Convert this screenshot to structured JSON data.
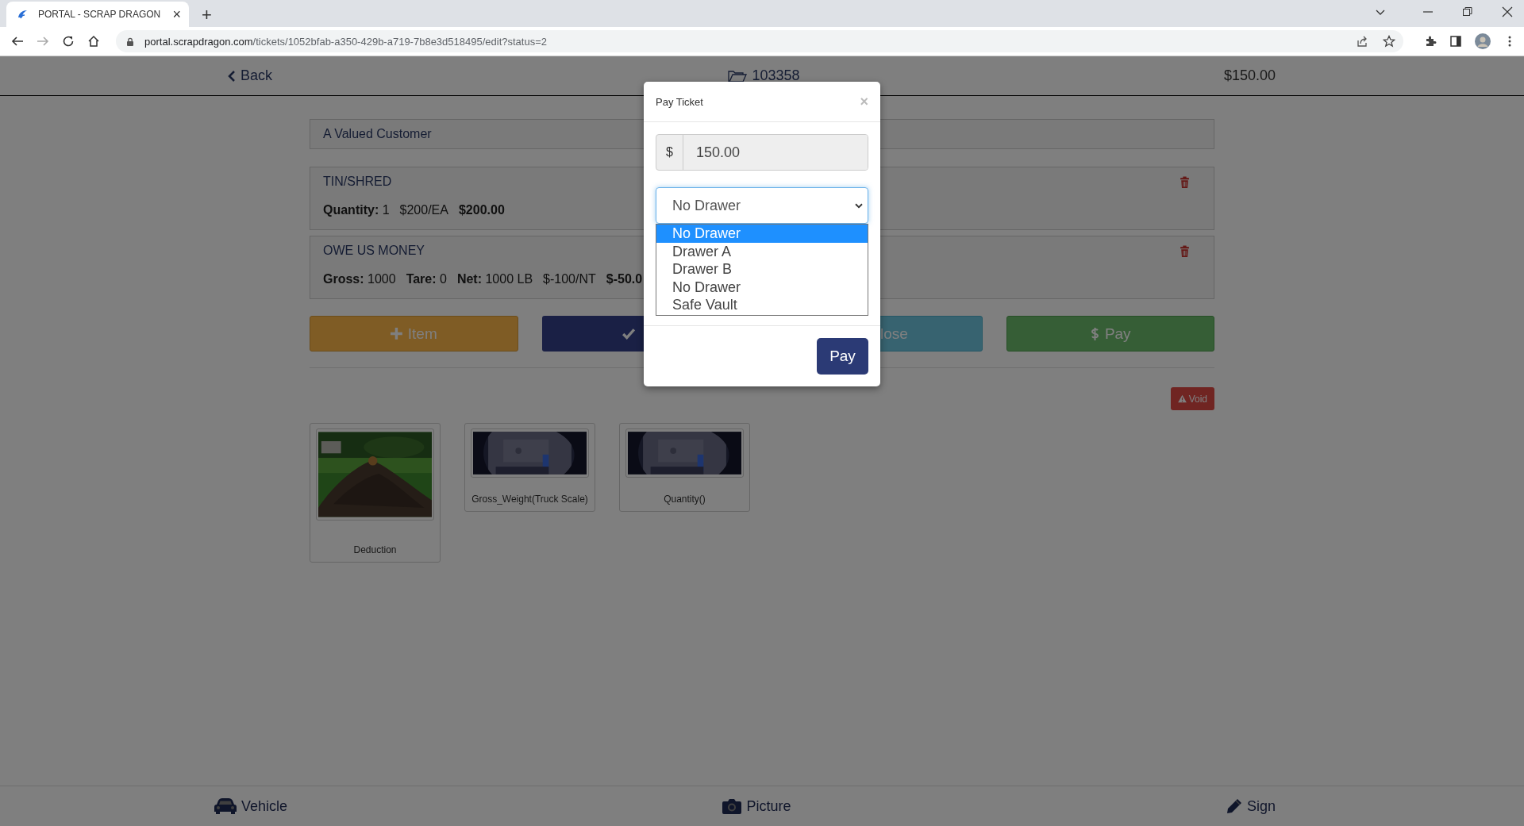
{
  "browser": {
    "tab_title": "PORTAL - SCRAP DRAGON",
    "tab_close": "×",
    "new_tab": "+",
    "url_host": "portal.scrapdragon.com",
    "url_path": "/tickets/1052bfab-a350-429b-a719-7b8e3d518495/edit?status=2"
  },
  "header": {
    "back": "Back",
    "ticket_number": "103358",
    "total": "$150.00"
  },
  "customer": "A Valued Customer",
  "items": [
    {
      "name": "TIN/SHRED",
      "parts": [
        "**Quantity:** 1",
        "$200/EA",
        "**$200.00**"
      ]
    },
    {
      "name": "OWE US MONEY",
      "parts": [
        "**Gross:** 1000",
        "**Tare:** 0",
        "**Net:** 1000 LB",
        "$-100/NT",
        "**$-50.0**"
      ]
    }
  ],
  "actions": [
    {
      "kind": "item",
      "label": "Item"
    },
    {
      "kind": "complete"
    },
    {
      "kind": "close",
      "label": "lose"
    },
    {
      "kind": "pay",
      "label": "Pay"
    }
  ],
  "void": "Void",
  "photos": [
    {
      "caption": "Deduction"
    },
    {
      "caption": "Gross_Weight(Truck Scale)"
    },
    {
      "caption": "Quantity()"
    }
  ],
  "bottom_nav": [
    {
      "kind": "vehicle",
      "label": "Vehicle"
    },
    {
      "kind": "camera",
      "label": "Picture"
    },
    {
      "kind": "pen",
      "label": "Sign"
    }
  ],
  "modal": {
    "title": "Pay Ticket",
    "close": "×",
    "currency": "$",
    "amount": "150.00",
    "select_value": "No Drawer",
    "options": [
      {
        "label": "No Drawer",
        "selected": true
      },
      {
        "label": "Drawer A",
        "selected": false
      },
      {
        "label": "Drawer B",
        "selected": false
      },
      {
        "label": "No Drawer",
        "selected": false
      },
      {
        "label": "Safe Vault",
        "selected": false
      }
    ],
    "submit": "Pay"
  }
}
